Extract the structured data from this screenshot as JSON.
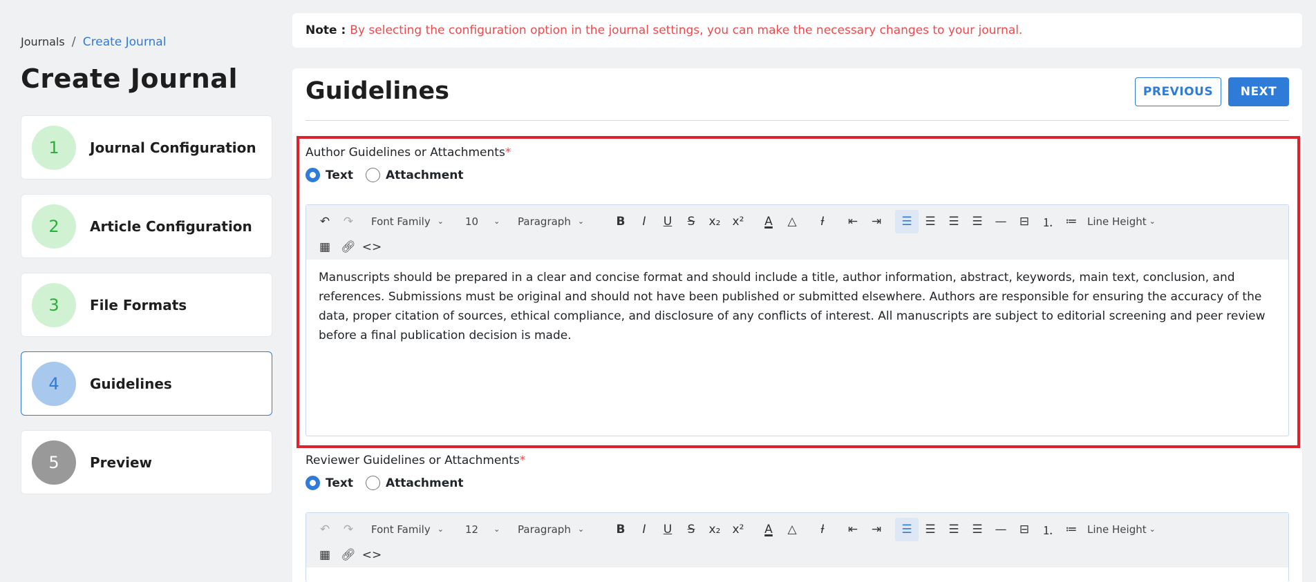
{
  "breadcrumb": {
    "root": "Journals",
    "separator": "/",
    "current": "Create Journal"
  },
  "page_title": "Create Journal",
  "steps": [
    {
      "num": "1",
      "label": "Journal Configuration",
      "state": "done"
    },
    {
      "num": "2",
      "label": "Article Configuration",
      "state": "done"
    },
    {
      "num": "3",
      "label": "File Formats",
      "state": "done"
    },
    {
      "num": "4",
      "label": "Guidelines",
      "state": "current"
    },
    {
      "num": "5",
      "label": "Preview",
      "state": "pending"
    }
  ],
  "note": {
    "label": "Note :",
    "text": "By selecting the configuration option in the journal settings, you can make the necessary changes to your journal."
  },
  "card": {
    "title": "Guidelines",
    "previous_label": "PREVIOUS",
    "next_label": "NEXT"
  },
  "author": {
    "label": "Author Guidelines or Attachments",
    "required": "*",
    "radio_text": "Text",
    "radio_attachment": "Attachment",
    "selected": "Text",
    "toolbar": {
      "font_family": "Font Family",
      "font_size": "10",
      "block": "Paragraph",
      "line_height": "Line Height"
    },
    "content": "Manuscripts should be prepared in a clear and concise format and should include a title, author information, abstract, keywords, main text, conclusion, and references. Submissions must be original and should not have been published or submitted elsewhere. Authors are responsible for ensuring the accuracy of the data, proper citation of sources, ethical compliance, and disclosure of any conflicts of interest. All manuscripts are subject to editorial screening and peer review before a final publication decision is made."
  },
  "reviewer": {
    "label": "Reviewer Guidelines or Attachments",
    "required": "*",
    "radio_text": "Text",
    "radio_attachment": "Attachment",
    "selected": "Text",
    "toolbar": {
      "font_family": "Font Family",
      "font_size": "12",
      "block": "Paragraph",
      "line_height": "Line Height"
    }
  },
  "colors": {
    "accent": "#2f7bd8",
    "note_text": "#f0484b",
    "highlight_border": "#e0202a",
    "step_done": "#d1f2d2",
    "step_pending": "#999999"
  }
}
